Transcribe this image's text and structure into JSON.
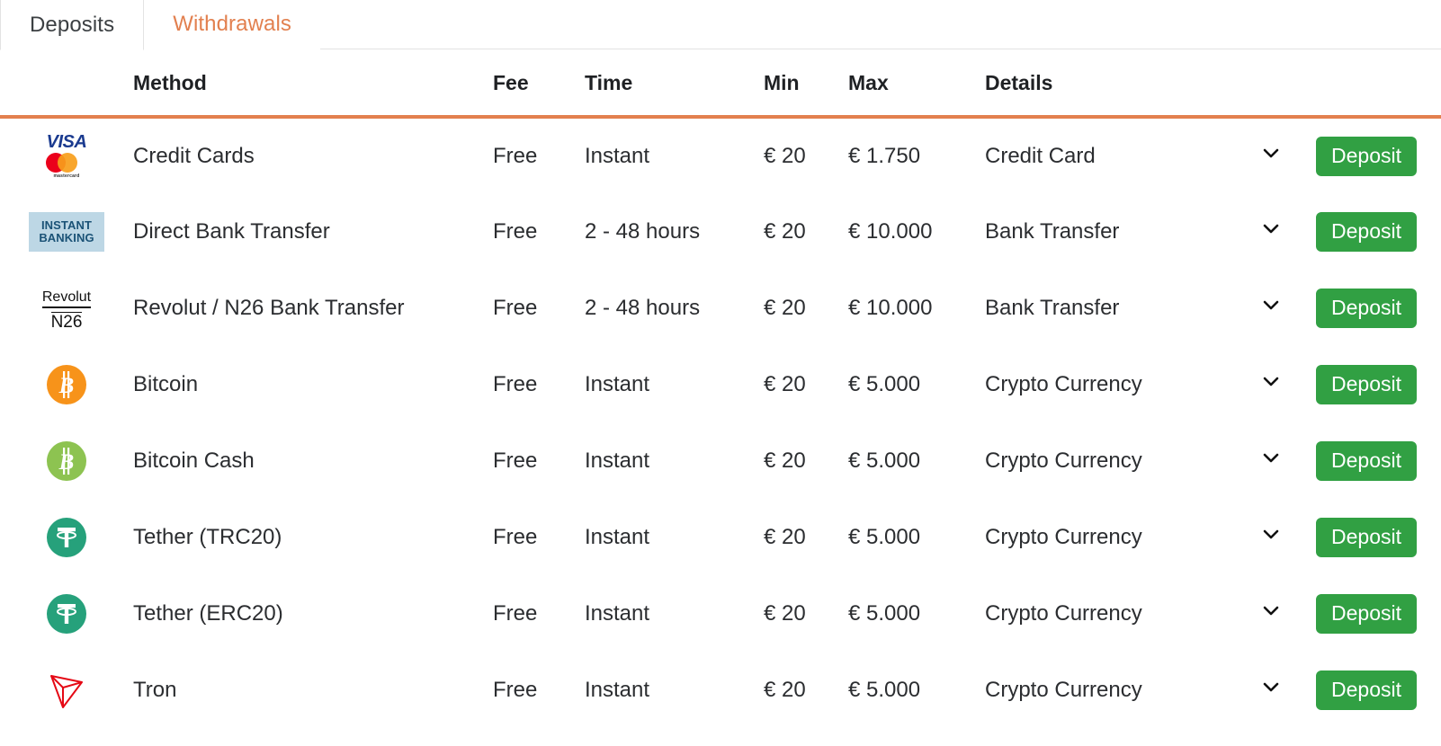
{
  "tabs": [
    {
      "label": "Deposits",
      "active": true
    },
    {
      "label": "Withdrawals",
      "active": false
    }
  ],
  "accent_color": "#e3804f",
  "button_color": "#31a043",
  "table": {
    "headers": {
      "logo": "",
      "method": "Method",
      "fee": "Fee",
      "time": "Time",
      "min": "Min",
      "max": "Max",
      "details": "Details",
      "chevron": "",
      "action": ""
    },
    "rows": [
      {
        "logo": "visa-mastercard-logo",
        "method": "Credit Cards",
        "fee": "Free",
        "time": "Instant",
        "min": "€ 20",
        "max": "€ 1.750",
        "details": "Credit Card",
        "expand": "chevron-down-icon",
        "action": "Deposit"
      },
      {
        "logo": "instant-banking-logo",
        "method": "Direct Bank Transfer",
        "fee": "Free",
        "time": "2 - 48 hours",
        "min": "€ 20",
        "max": "€ 10.000",
        "details": "Bank Transfer",
        "expand": "chevron-down-icon",
        "action": "Deposit"
      },
      {
        "logo": "revolut-n26-logo",
        "method": "Revolut / N26 Bank Transfer",
        "fee": "Free",
        "time": "2 - 48 hours",
        "min": "€ 20",
        "max": "€ 10.000",
        "details": "Bank Transfer",
        "expand": "chevron-down-icon",
        "action": "Deposit"
      },
      {
        "logo": "bitcoin-icon",
        "method": "Bitcoin",
        "fee": "Free",
        "time": "Instant",
        "min": "€ 20",
        "max": "€ 5.000",
        "details": "Crypto Currency",
        "expand": "chevron-down-icon",
        "action": "Deposit"
      },
      {
        "logo": "bitcoin-cash-icon",
        "method": "Bitcoin Cash",
        "fee": "Free",
        "time": "Instant",
        "min": "€ 20",
        "max": "€ 5.000",
        "details": "Crypto Currency",
        "expand": "chevron-down-icon",
        "action": "Deposit"
      },
      {
        "logo": "tether-icon",
        "method": "Tether (TRC20)",
        "fee": "Free",
        "time": "Instant",
        "min": "€ 20",
        "max": "€ 5.000",
        "details": "Crypto Currency",
        "expand": "chevron-down-icon",
        "action": "Deposit"
      },
      {
        "logo": "tether-icon",
        "method": "Tether (ERC20)",
        "fee": "Free",
        "time": "Instant",
        "min": "€ 20",
        "max": "€ 5.000",
        "details": "Crypto Currency",
        "expand": "chevron-down-icon",
        "action": "Deposit"
      },
      {
        "logo": "tron-icon",
        "method": "Tron",
        "fee": "Free",
        "time": "Instant",
        "min": "€ 20",
        "max": "€ 5.000",
        "details": "Crypto Currency",
        "expand": "chevron-down-icon",
        "action": "Deposit"
      }
    ]
  },
  "logo_text": {
    "visa": "VISA",
    "mastercard": "mastercard",
    "instant_banking_line1": "INSTANT",
    "instant_banking_line2": "BANKING",
    "revolut": "Revolut",
    "n26": "N26"
  }
}
